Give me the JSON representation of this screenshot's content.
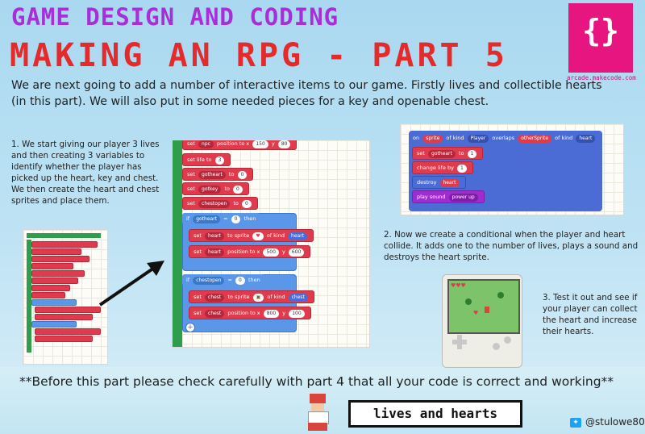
{
  "header": {
    "title_line1": "GAME DESIGN AND CODING",
    "title_line2": "MAKING AN RPG - PART 5",
    "intro": "We are next going to add a number of interactive items to our game. Firstly lives and collectible hearts (in this part). We will also put in some needed pieces for a key and openable chest."
  },
  "logo": {
    "glyph": "{}",
    "url": "arcade.makecode.com"
  },
  "step1": {
    "text": "1. We start giving our player 3 lives and then creating 3 variables to identify whether the player has picked up the heart, key and chest. We then create the heart and chest sprites and place them."
  },
  "step2": {
    "text": "2. Now we create a conditional when the player and heart collide. It adds one to the number of lives, plays a sound and destroys the heart sprite."
  },
  "step3": {
    "text": "3. Test it out and see if your player can collect the heart and increase their hearts."
  },
  "code_main": {
    "set_npc": "set",
    "npc": "npc",
    "pos_to_x": "position to x",
    "npc_x": "150",
    "y": "y",
    "npc_y": "80",
    "set_life": "set life to",
    "life_val": "3",
    "set_label": "set",
    "gotheart": "gotheart",
    "gotkey": "gotkey",
    "chestopen": "chestopen",
    "to": "to",
    "zero": "0",
    "if": "if",
    "eq": "=",
    "then": "then",
    "heart": "heart",
    "chest": "chest",
    "sprite": "sprite",
    "of_kind": "of kind",
    "heart_kind": "heart",
    "chest_kind": "chest",
    "heart_x": "500",
    "heart_y": "600",
    "chest_x": "800",
    "chest_y": "100"
  },
  "code_overlap": {
    "on": "on",
    "sprite": "sprite",
    "of_kind": "of kind",
    "player": "Player",
    "overlaps": "overlaps",
    "other": "otherSprite",
    "heart": "heart",
    "set": "set",
    "gotheart": "gotheart",
    "to": "to",
    "one": "1",
    "change_life": "change life by",
    "destroy": "destroy",
    "play_sound": "play sound",
    "power_up": "power up"
  },
  "bottom_note": "**Before this part please check carefully with part 4 that all your code is correct and working**",
  "speech": "lives and hearts",
  "twitter": "@stulowe80",
  "colors": {
    "title1": "#a82fd8",
    "title2": "#e42a2a",
    "logo": "#e6157f"
  }
}
